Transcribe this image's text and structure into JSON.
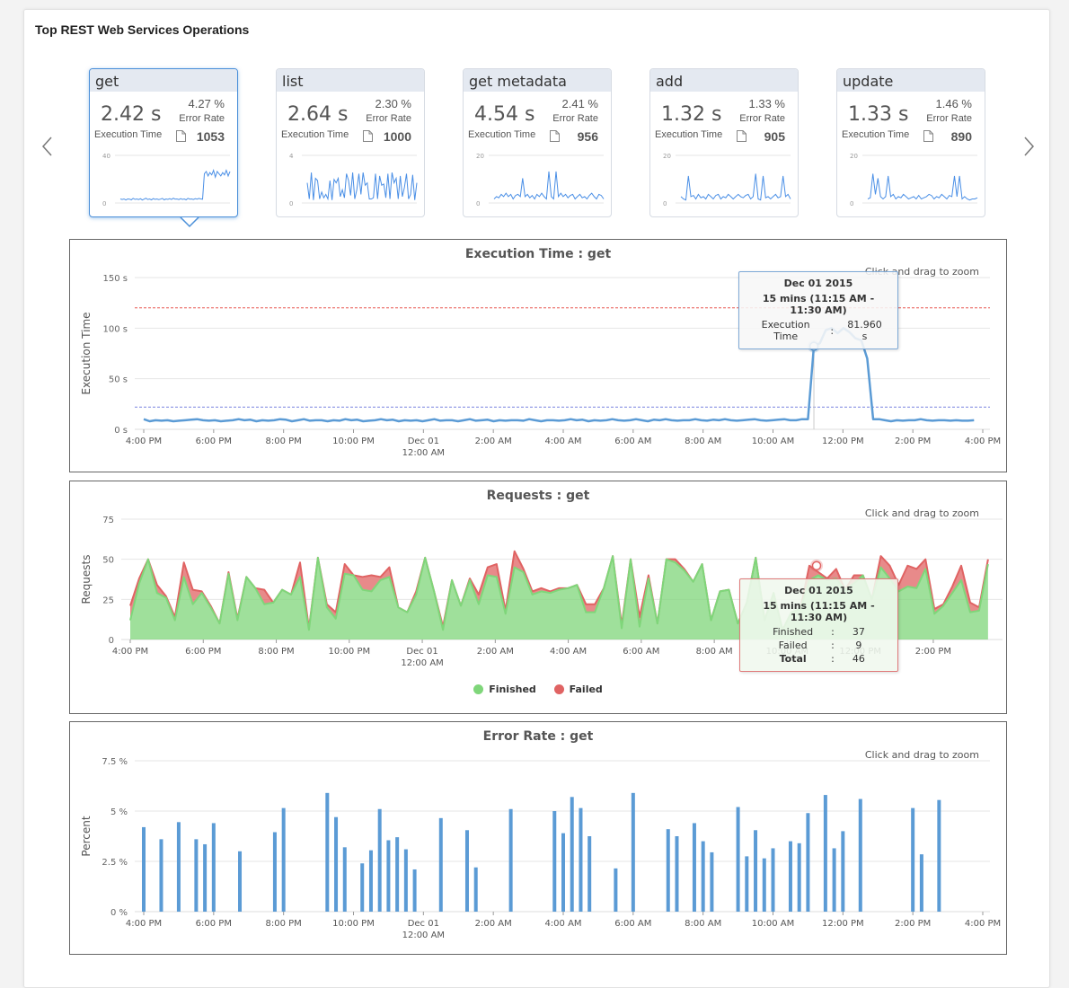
{
  "panel": {
    "title": "Top REST Web Services Operations"
  },
  "nav": {
    "prev_icon": "chevron-left-icon",
    "next_icon": "chevron-right-icon"
  },
  "cards": [
    {
      "name": "get",
      "exec_time": "2.42 s",
      "exec_label": "Execution Time",
      "error_rate": "4.27 %",
      "error_label": "Error Rate",
      "count": "1053",
      "spark_max_label": "40",
      "spark_min_label": "0",
      "spark_max": 40,
      "selected": true,
      "spark": [
        2,
        1.5,
        2,
        1,
        2,
        1.8,
        1.2,
        2.5,
        1.6,
        2,
        1.4,
        2.2,
        1,
        1.8,
        2.6,
        1.5,
        2,
        1.2,
        2.3,
        1.6,
        2,
        1.4,
        1.8,
        2.4,
        1.2,
        2,
        1.6,
        2.2,
        1.5,
        2.6,
        1.8,
        2,
        1.4,
        2.2,
        1.6,
        2,
        1.2,
        2.5,
        1.8,
        2,
        1.5,
        2.2,
        1.8,
        2.4,
        2,
        1.7,
        24,
        26,
        22,
        25,
        23,
        27,
        21,
        26,
        24,
        22,
        25,
        23,
        27,
        22,
        26
      ]
    },
    {
      "name": "list",
      "exec_time": "2.64 s",
      "exec_label": "Execution Time",
      "error_rate": "2.30 %",
      "error_label": "Error Rate",
      "count": "1000",
      "spark_max_label": "4",
      "spark_min_label": "0",
      "spark_max": 4,
      "spark": [
        1.6,
        0.2,
        2.5,
        0.1,
        2,
        1.8,
        0.2,
        0.8,
        0.3,
        0.6,
        0.2,
        1.8,
        0.1,
        1.9,
        1.6,
        2,
        0.4,
        1,
        0.3,
        2.4,
        1.8,
        0.5,
        2.5,
        0.2,
        1,
        2.4,
        0.6,
        2.5,
        1.4,
        1.6,
        0.2,
        0.2,
        0.3,
        2.4,
        0.2,
        2.2,
        1.4,
        1.5,
        0.3,
        2.4,
        0.2,
        2.5,
        1.6,
        2,
        0.2,
        2.2,
        0.4,
        1.2,
        2.4,
        0.2,
        0.6,
        2.3,
        0.1,
        1.6
      ]
    },
    {
      "name": "get metadata",
      "exec_time": "4.54 s",
      "exec_label": "Execution Time",
      "error_rate": "2.41 %",
      "error_label": "Error Rate",
      "count": "956",
      "spark_max_label": "20",
      "spark_min_label": "0",
      "spark_max": 20,
      "spark": [
        1,
        2,
        1.5,
        3,
        2,
        3.5,
        2,
        3,
        1,
        2.5,
        3,
        2,
        10,
        2,
        3,
        1.5,
        2.5,
        1,
        3,
        2,
        3.5,
        2,
        1,
        13,
        2,
        1,
        13,
        2,
        3.5,
        2,
        3,
        1.5,
        2.5,
        3,
        1,
        2,
        3,
        1.5,
        2,
        1,
        2.5,
        3.5,
        2,
        1,
        3,
        2.5,
        1
      ]
    },
    {
      "name": "add",
      "exec_time": "1.32 s",
      "exec_label": "Execution Time",
      "error_rate": "1.33 %",
      "error_label": "Error Rate",
      "count": "905",
      "spark_max_label": "20",
      "spark_min_label": "0",
      "spark_max": 20,
      "spark": [
        2,
        1,
        0.5,
        11,
        2,
        2.5,
        1,
        3,
        1.5,
        2,
        1,
        3,
        2,
        1,
        2.5,
        3,
        1,
        2,
        1.5,
        3,
        2,
        1,
        2,
        3,
        2,
        1.5,
        2.5,
        3,
        1,
        2,
        12,
        1,
        0.5,
        11,
        1.5,
        2,
        1,
        2,
        3,
        1.5,
        2,
        11,
        2,
        3,
        1
      ]
    },
    {
      "name": "update",
      "exec_time": "1.33 s",
      "exec_label": "Execution Time",
      "error_rate": "1.46 %",
      "error_label": "Error Rate",
      "count": "890",
      "spark_max_label": "20",
      "spark_min_label": "0",
      "spark_max": 20,
      "spark": [
        1,
        1.5,
        12,
        3,
        10,
        2,
        1,
        2,
        11,
        2,
        3,
        1,
        2,
        1.5,
        3,
        2,
        1,
        1.5,
        2,
        1,
        2.5,
        1,
        1.5,
        2,
        3,
        2.5,
        1,
        2,
        1.5,
        3,
        2,
        1,
        2.5,
        2,
        11,
        2,
        11,
        1,
        2,
        1,
        0.5,
        1,
        1,
        1.5
      ]
    }
  ],
  "charts": {
    "zoom_hint": "Click and drag to zoom"
  },
  "chart_data": [
    {
      "type": "line",
      "title": "Execution Time : get",
      "ylabel": "Execution Time",
      "xlabel": "",
      "ylim": [
        0,
        150
      ],
      "yticks": [
        "0 s",
        "50 s",
        "100 s",
        "150 s"
      ],
      "ytick_values": [
        0,
        50,
        100,
        150
      ],
      "xticks": [
        "4:00 PM",
        "6:00 PM",
        "8:00 PM",
        "10:00 PM",
        "Dec 01|12:00 AM",
        "2:00 AM",
        "4:00 AM",
        "6:00 AM",
        "8:00 AM",
        "10:00 AM",
        "12:00 PM",
        "2:00 PM",
        "4:00 PM"
      ],
      "x_range_hours": [
        0,
        24
      ],
      "x_start": "Nov 30 2015 4:00 PM",
      "interval_minutes": 15,
      "thresholds": [
        {
          "name": "critical",
          "value": 120,
          "color": "#e8554e"
        },
        {
          "name": "warning",
          "value": 22,
          "color": "#7b86e0"
        }
      ],
      "series": [
        {
          "name": "Execution Time",
          "color": "#5b9bd5",
          "values": [
            10,
            8,
            9,
            8.5,
            9,
            8,
            8.5,
            9,
            9.5,
            10,
            9,
            8.5,
            9,
            8,
            8.5,
            9,
            10,
            9,
            9.5,
            8,
            9,
            8.5,
            9,
            10,
            9.5,
            8,
            9,
            10,
            8.5,
            9,
            9,
            8,
            9,
            8.5,
            10,
            9,
            9.5,
            8,
            8.5,
            9,
            10,
            9,
            9.5,
            8,
            9,
            8.5,
            9,
            8,
            9,
            10,
            8.5,
            9,
            9,
            8,
            9,
            10,
            8.5,
            9,
            9.5,
            8,
            9,
            8.5,
            9,
            9,
            8.5,
            10,
            9,
            8,
            9,
            9,
            8.5,
            9,
            10,
            9,
            9.5,
            8,
            9,
            8.5,
            9,
            10,
            9,
            8.5,
            9,
            10,
            9,
            8,
            9.5,
            9,
            10,
            9,
            8.5,
            9,
            9,
            10,
            9,
            8.5,
            9.5,
            9,
            10,
            9,
            8.5,
            9,
            9.5,
            10,
            9,
            8.5,
            9,
            9.5,
            10,
            9,
            9,
            10,
            10,
            81.96,
            85,
            98,
            100,
            95,
            100,
            96,
            90,
            88,
            70,
            10,
            10,
            9,
            8,
            9,
            8.5,
            9,
            9,
            10,
            9,
            8.5,
            9,
            9,
            8.5,
            9,
            8.5,
            8.5,
            9
          ]
        }
      ],
      "tooltip": {
        "date": "Dec 01 2015",
        "range": "15 mins (11:15 AM - 11:30 AM)",
        "label": "Execution Time",
        "sep": ":",
        "value": "81.960 s"
      }
    },
    {
      "type": "area",
      "stacked": true,
      "title": "Requests : get",
      "ylabel": "Requests",
      "xlabel": "",
      "ylim": [
        0,
        75
      ],
      "yticks": [
        "0",
        "25",
        "50",
        "75"
      ],
      "ytick_values": [
        0,
        25,
        50,
        75
      ],
      "xticks": [
        "4:00 PM",
        "6:00 PM",
        "8:00 PM",
        "10:00 PM",
        "Dec 01|12:00 AM",
        "2:00 AM",
        "4:00 AM",
        "6:00 AM",
        "8:00 AM",
        "10:00 AM",
        "12:00 PM",
        "2:00 PM"
      ],
      "x_range_hours": [
        0,
        23.5
      ],
      "series": [
        {
          "name": "Finished",
          "color": "#7fd67a",
          "values": [
            12,
            35,
            50,
            29,
            26,
            12,
            39,
            22,
            29,
            20,
            10,
            41,
            12,
            39,
            32,
            22,
            23,
            31,
            28,
            39,
            6,
            51,
            20,
            13,
            41,
            40,
            31,
            30,
            37,
            39,
            20,
            17,
            28,
            51,
            30,
            6,
            37,
            21,
            37,
            22,
            40,
            39,
            16,
            45,
            42,
            28,
            30,
            29,
            31,
            32,
            34,
            17,
            17,
            32,
            52,
            7,
            50,
            8,
            38,
            10,
            50,
            48,
            43,
            36,
            47,
            12,
            30,
            31,
            10,
            23,
            51,
            12,
            29,
            6,
            17,
            19,
            37,
            40,
            37,
            38,
            31,
            35,
            40,
            25,
            45,
            38,
            30,
            33,
            32,
            44,
            16,
            21,
            29,
            37,
            17,
            18,
            47
          ]
        },
        {
          "name": "Failed",
          "color": "#e06363",
          "values": [
            9,
            3,
            0,
            5,
            1,
            2,
            9,
            9,
            1,
            1,
            0,
            1,
            1,
            0,
            0,
            9,
            0,
            0,
            0,
            9,
            1,
            0,
            2,
            4,
            6,
            0,
            8,
            10,
            2,
            6,
            0,
            0,
            2,
            0,
            0,
            2,
            0,
            0,
            1,
            6,
            5,
            8,
            2,
            10,
            2,
            2,
            2,
            1,
            1,
            0,
            0,
            5,
            5,
            0,
            0,
            2,
            0,
            6,
            2,
            0,
            0,
            2,
            1,
            0,
            0,
            0,
            0,
            0,
            0,
            0,
            0,
            0,
            0,
            0,
            0,
            0,
            9,
            2,
            1,
            6,
            0,
            5,
            0,
            0,
            7,
            8,
            4,
            13,
            12,
            6,
            3,
            1,
            4,
            9,
            6,
            2,
            3
          ]
        }
      ],
      "legend": [
        "Finished",
        "Failed"
      ],
      "legend_position": "bottom",
      "tooltip": {
        "date": "Dec 01 2015",
        "range": "15 mins (11:15 AM - 11:30 AM)",
        "rows": [
          {
            "label": "Finished",
            "sep": ":",
            "value": "37"
          },
          {
            "label": "Failed",
            "sep": ":",
            "value": "9"
          },
          {
            "label": "Total",
            "sep": ":",
            "value": "46"
          }
        ]
      }
    },
    {
      "type": "bar",
      "title": "Error Rate : get",
      "ylabel": "Percent",
      "xlabel": "",
      "ylim": [
        0,
        7.5
      ],
      "yticks": [
        "0 %",
        "2.5 %",
        "5 %",
        "7.5 %"
      ],
      "ytick_values": [
        0,
        2.5,
        5,
        7.5
      ],
      "xticks": [
        "4:00 PM",
        "6:00 PM",
        "8:00 PM",
        "10:00 PM",
        "Dec 01|12:00 AM",
        "2:00 AM",
        "4:00 AM",
        "6:00 AM",
        "8:00 AM",
        "10:00 AM",
        "12:00 PM",
        "2:00 PM",
        "4:00 PM"
      ],
      "x_range_hours": [
        0,
        24
      ],
      "series": [
        {
          "name": "Error Rate",
          "color": "#5b9bd5",
          "points": [
            [
              0,
              4.2
            ],
            [
              0.5,
              3.6
            ],
            [
              1.0,
              4.45
            ],
            [
              1.5,
              3.6
            ],
            [
              1.75,
              3.35
            ],
            [
              2.0,
              4.4
            ],
            [
              2.75,
              3.0
            ],
            [
              3.75,
              3.95
            ],
            [
              4.0,
              5.15
            ],
            [
              5.25,
              5.9
            ],
            [
              5.5,
              4.7
            ],
            [
              5.75,
              3.2
            ],
            [
              6.25,
              2.4
            ],
            [
              6.5,
              3.05
            ],
            [
              6.75,
              5.1
            ],
            [
              7.0,
              3.55
            ],
            [
              7.25,
              3.7
            ],
            [
              7.5,
              3.1
            ],
            [
              7.75,
              2.1
            ],
            [
              8.5,
              4.65
            ],
            [
              9.25,
              4.05
            ],
            [
              9.5,
              2.2
            ],
            [
              10.5,
              5.1
            ],
            [
              11.75,
              5.0
            ],
            [
              12.0,
              3.9
            ],
            [
              12.25,
              5.7
            ],
            [
              12.5,
              5.15
            ],
            [
              12.75,
              3.75
            ],
            [
              13.5,
              2.15
            ],
            [
              14.0,
              5.9
            ],
            [
              15.0,
              4.1
            ],
            [
              15.25,
              3.75
            ],
            [
              15.75,
              4.4
            ],
            [
              16.0,
              3.5
            ],
            [
              16.25,
              2.95
            ],
            [
              17.0,
              5.2
            ],
            [
              17.25,
              2.75
            ],
            [
              17.5,
              4.05
            ],
            [
              17.75,
              2.65
            ],
            [
              18.0,
              3.15
            ],
            [
              18.5,
              3.5
            ],
            [
              18.75,
              3.4
            ],
            [
              19.0,
              4.9
            ],
            [
              19.5,
              5.8
            ],
            [
              19.75,
              3.15
            ],
            [
              20.0,
              4.0
            ],
            [
              20.5,
              5.6
            ],
            [
              22.0,
              5.15
            ],
            [
              22.25,
              2.85
            ],
            [
              22.75,
              5.55
            ]
          ]
        }
      ]
    }
  ]
}
